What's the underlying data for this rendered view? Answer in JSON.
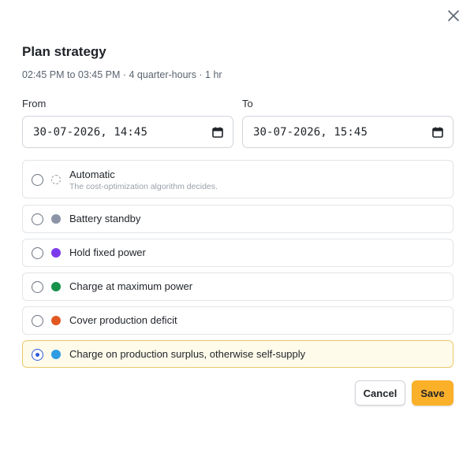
{
  "dialog": {
    "title": "Plan strategy",
    "subtitle": "02:45 PM to 03:45 PM · 4 quarter-hours · 1 hr",
    "close_icon": "close-icon"
  },
  "from": {
    "label": "From",
    "value": "30-07-2026, 14:45",
    "icon": "calendar-icon"
  },
  "to": {
    "label": "To",
    "value": "30-07-2026, 15:45",
    "icon": "calendar-icon"
  },
  "options": [
    {
      "label": "Automatic",
      "description": "The cost-optimization algorithm decides.",
      "color": "",
      "selected": false
    },
    {
      "label": "Battery standby",
      "color": "#8a94a6",
      "selected": false
    },
    {
      "label": "Hold fixed power",
      "color": "#7c3aed",
      "selected": false
    },
    {
      "label": "Charge at maximum power",
      "color": "#16924a",
      "selected": false
    },
    {
      "label": "Cover production deficit",
      "color": "#e25822",
      "selected": false
    },
    {
      "label": "Charge on production surplus, otherwise self-supply",
      "color": "#2e9be3",
      "selected": true
    }
  ],
  "actions": {
    "cancel_label": "Cancel",
    "save_label": "Save",
    "save_color": "#fbb02a"
  }
}
